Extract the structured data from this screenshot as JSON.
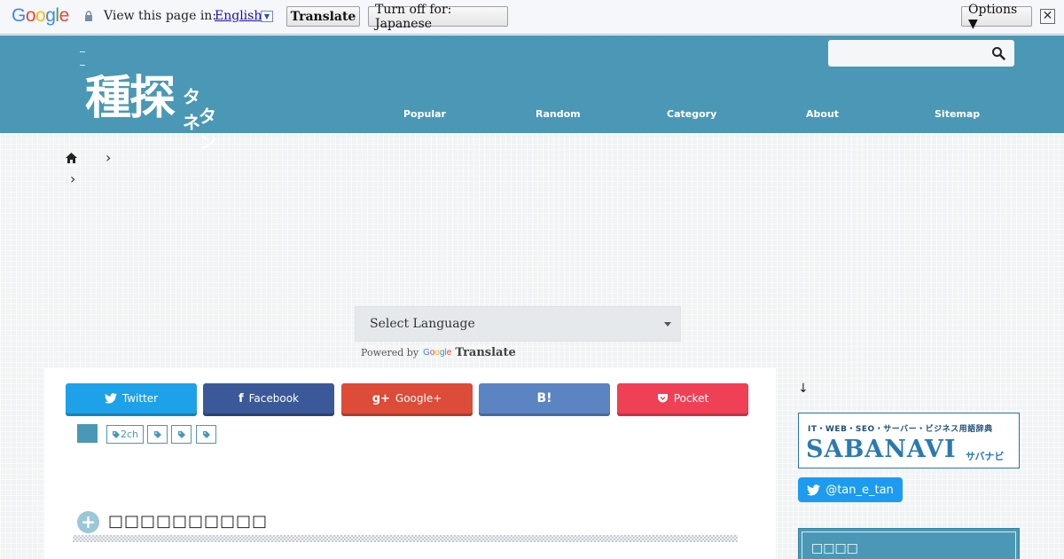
{
  "translate_bar": {
    "logo": "Google",
    "logo_colors": [
      "#4285f4",
      "#ea4335",
      "#fbbc05",
      "#4285f4",
      "#34a853",
      "#ea4335"
    ],
    "view_label": "View this page in:",
    "language": "English",
    "translate_button": "Translate",
    "turn_off_button": "Turn off for: Japanese",
    "options_button": "Options ▼",
    "close": "✕"
  },
  "header": {
    "logo_main": "種探",
    "logo_kana_1": "タネ",
    "logo_kana_2": "タン",
    "search_placeholder": "",
    "nav": [
      "Popular",
      "Random",
      "Category",
      "About",
      "Sitemap"
    ],
    "background_color": "#4a98b5"
  },
  "breadcrumb": {
    "separator": "›"
  },
  "language_selector": {
    "value": "Select Language",
    "powered_by": "Powered by",
    "google": "Google",
    "translate": "Translate"
  },
  "share": {
    "twitter": "Twitter",
    "facebook": "Facebook",
    "googleplus": "Google+",
    "hatena": "B!",
    "pocket": "Pocket"
  },
  "tags": [
    "2ch",
    "",
    "",
    ""
  ],
  "section": {
    "title": "□□□□□□□□□□"
  },
  "sidebar": {
    "arrow": "↓",
    "banner_sub": "IT・WEB・SEO・サーバー・ビジネス用語辞典",
    "banner_main": "SABANAVI",
    "banner_kana": "サバナビ",
    "twitter_handle": "@tan_e_tan",
    "box_title": "□□□□"
  }
}
